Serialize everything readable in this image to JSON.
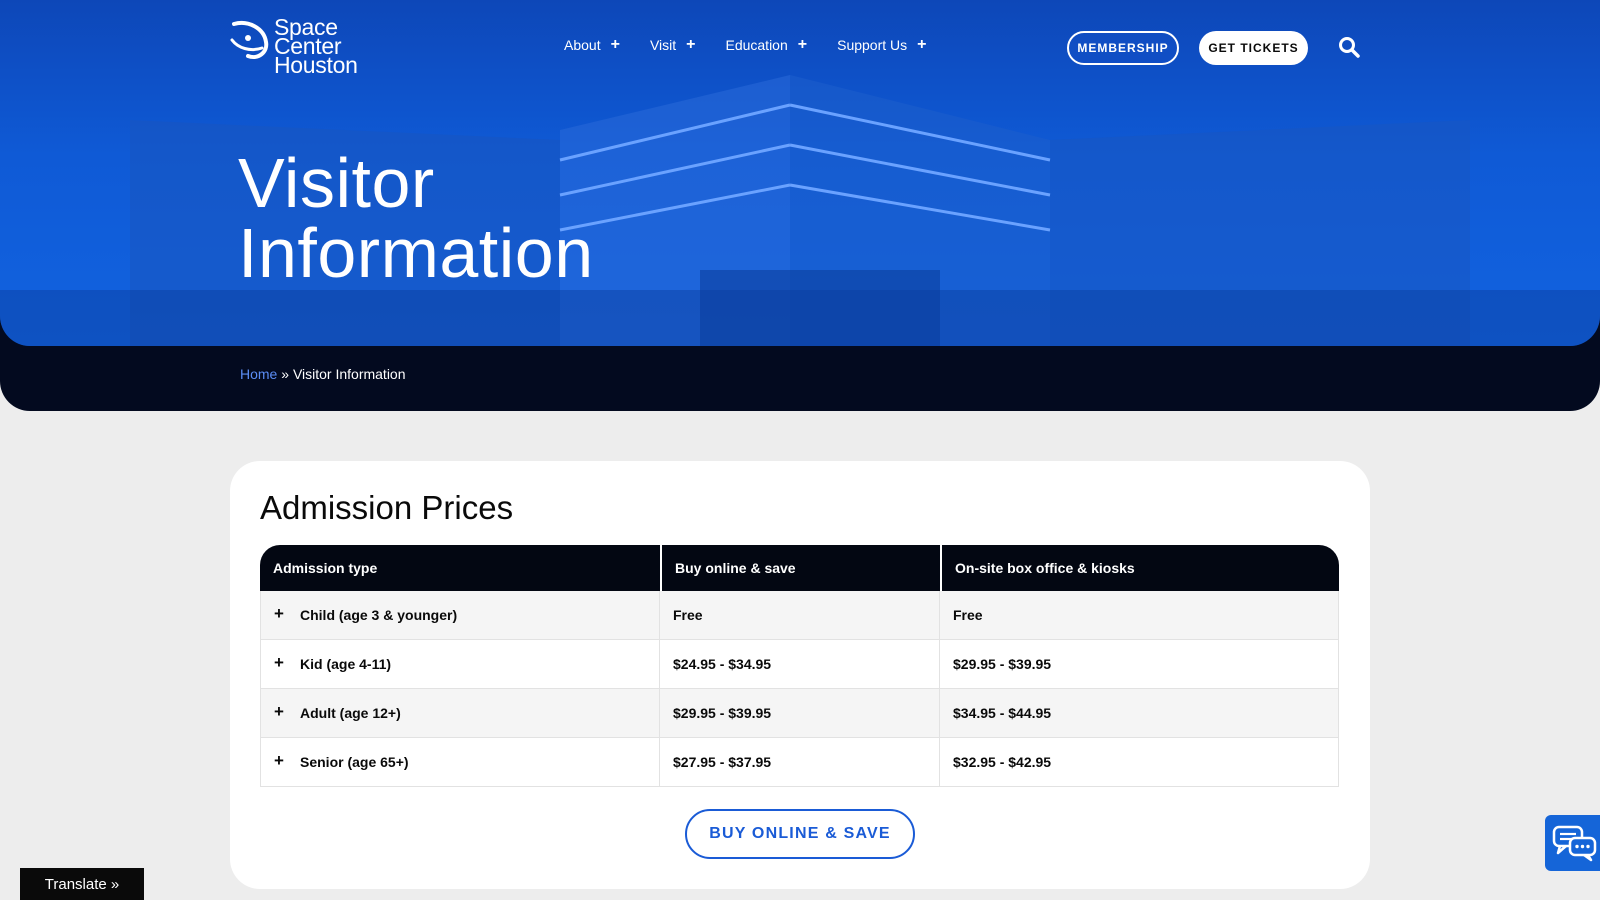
{
  "logo": {
    "lines": [
      "Space",
      "Center",
      "Houston"
    ]
  },
  "nav": {
    "items": [
      {
        "label": "About"
      },
      {
        "label": "Visit"
      },
      {
        "label": "Education"
      },
      {
        "label": "Support Us"
      }
    ],
    "plus": "+"
  },
  "header": {
    "membership_label": "MEMBERSHIP",
    "tickets_label": "GET TICKETS"
  },
  "hero": {
    "title_lines": [
      "Visitor",
      "Information"
    ]
  },
  "breadcrumb": {
    "home": "Home",
    "separator": " » ",
    "current": "Visitor Information"
  },
  "admission": {
    "title": "Admission Prices",
    "columns": [
      "Admission type",
      "Buy online & save",
      "On-site box office & kiosks"
    ],
    "rows": [
      {
        "type": "Child (age 3 & younger)",
        "online": "Free",
        "onsite": "Free"
      },
      {
        "type": "Kid (age 4-11)",
        "online": "$24.95 - $34.95",
        "onsite": "$29.95 - $39.95"
      },
      {
        "type": "Adult (age 12+)",
        "online": "$29.95 - $39.95",
        "onsite": "$34.95 - $44.95"
      },
      {
        "type": "Senior (age 65+)",
        "online": "$27.95 - $37.95",
        "onsite": "$32.95 - $42.95"
      }
    ],
    "row_toggle": "+",
    "buy_label": "BUY ONLINE & SAVE"
  },
  "translate": {
    "label": "Translate »"
  },
  "colors": {
    "hero_blue": "#0f5ad6",
    "dark": "#030712",
    "accent": "#1a5bd6"
  }
}
